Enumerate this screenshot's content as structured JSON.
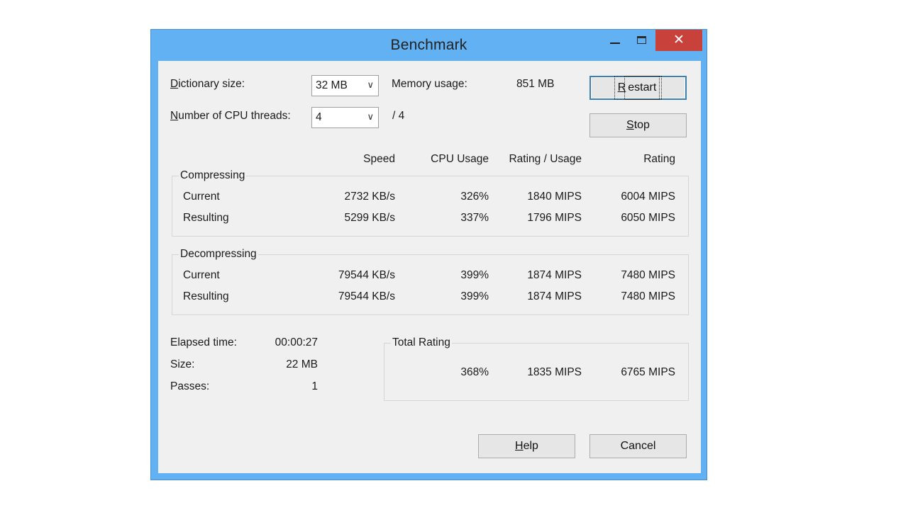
{
  "window": {
    "title": "Benchmark",
    "close_glyph": "✕"
  },
  "settings": {
    "dictionary_label_first": "D",
    "dictionary_label_rest": "ictionary size:",
    "dictionary_value": "32 MB",
    "threads_label_first": "N",
    "threads_label_rest": "umber of CPU threads:",
    "threads_value": "4",
    "threads_total": "/ 4",
    "memory_label": "Memory usage:",
    "memory_value": "851 MB",
    "dropdown_glyph": "∨"
  },
  "buttons": {
    "restart_first": "R",
    "restart_rest": "estart",
    "stop_first": "S",
    "stop_rest": "top",
    "help_first": "H",
    "help_rest": "elp",
    "cancel": "Cancel"
  },
  "columns": {
    "speed": "Speed",
    "cpu_usage": "CPU Usage",
    "rating_usage": "Rating / Usage",
    "rating": "Rating"
  },
  "compressing": {
    "title": "Compressing",
    "rows": [
      {
        "label": "Current",
        "speed": "2732 KB/s",
        "cpu": "326%",
        "rating_usage": "1840 MIPS",
        "rating": "6004 MIPS"
      },
      {
        "label": "Resulting",
        "speed": "5299 KB/s",
        "cpu": "337%",
        "rating_usage": "1796 MIPS",
        "rating": "6050 MIPS"
      }
    ]
  },
  "decompressing": {
    "title": "Decompressing",
    "rows": [
      {
        "label": "Current",
        "speed": "79544 KB/s",
        "cpu": "399%",
        "rating_usage": "1874 MIPS",
        "rating": "7480 MIPS"
      },
      {
        "label": "Resulting",
        "speed": "79544 KB/s",
        "cpu": "399%",
        "rating_usage": "1874 MIPS",
        "rating": "7480 MIPS"
      }
    ]
  },
  "stats": {
    "elapsed_label": "Elapsed time:",
    "elapsed_value": "00:00:27",
    "size_label": "Size:",
    "size_value": "22 MB",
    "passes_label": "Passes:",
    "passes_value": "1"
  },
  "total": {
    "title": "Total Rating",
    "cpu": "368%",
    "rating_usage": "1835 MIPS",
    "rating": "6765 MIPS"
  }
}
